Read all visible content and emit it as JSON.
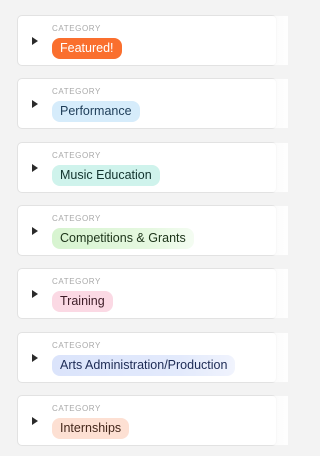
{
  "categories": [
    {
      "caption": "CATEGORY",
      "label": "Featured!"
    },
    {
      "caption": "CATEGORY",
      "label": "Performance"
    },
    {
      "caption": "CATEGORY",
      "label": "Music Education"
    },
    {
      "caption": "CATEGORY",
      "label": "Competitions & Grants"
    },
    {
      "caption": "CATEGORY",
      "label": "Training"
    },
    {
      "caption": "CATEGORY",
      "label": "Arts Administration/Production"
    },
    {
      "caption": "CATEGORY",
      "label": "Internships"
    }
  ],
  "icons": {
    "expand": "caret-right-icon"
  },
  "colors": {
    "featured": "#fa6f2e",
    "performance": "#d6ecfb",
    "music_education": "#cff3ec",
    "competitions_grants": "#d7f4d0",
    "training": "#fbd9e4",
    "arts_administration": "#dbe4fb",
    "internships": "#fde0d3"
  }
}
